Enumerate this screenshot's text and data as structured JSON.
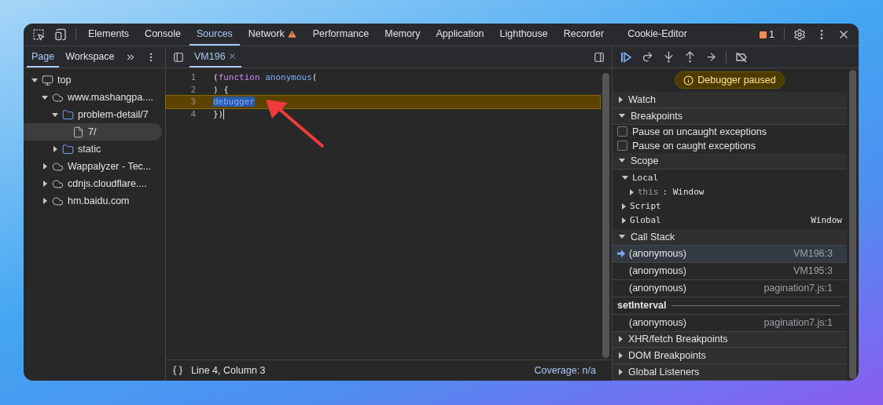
{
  "main_tabs": [
    {
      "label": "Elements",
      "selected": false,
      "warning": false
    },
    {
      "label": "Console",
      "selected": false,
      "warning": false
    },
    {
      "label": "Sources",
      "selected": true,
      "warning": false
    },
    {
      "label": "Network",
      "selected": false,
      "warning": true
    },
    {
      "label": "Performance",
      "selected": false,
      "warning": false
    },
    {
      "label": "Memory",
      "selected": false,
      "warning": false
    },
    {
      "label": "Application",
      "selected": false,
      "warning": false
    },
    {
      "label": "Lighthouse",
      "selected": false,
      "warning": false
    },
    {
      "label": "Recorder",
      "selected": false,
      "warning": false
    },
    {
      "label": "Cookie-Editor",
      "selected": false,
      "warning": false
    }
  ],
  "issues_count": "1",
  "navigator": {
    "tabs": [
      {
        "label": "Page",
        "selected": true
      },
      {
        "label": "Workspace",
        "selected": false
      }
    ],
    "tree": [
      {
        "label": "top",
        "kind": "frame",
        "expanded": true,
        "selected": false,
        "children": [
          {
            "label": "www.mashangpa....",
            "kind": "domain",
            "expanded": true,
            "selected": false,
            "children": [
              {
                "label": "problem-detail/7",
                "kind": "folder",
                "expanded": true,
                "selected": false,
                "children": [
                  {
                    "label": "7/",
                    "kind": "file",
                    "expanded": false,
                    "selected": true
                  }
                ]
              },
              {
                "label": "static",
                "kind": "folder",
                "expanded": false,
                "selected": false
              }
            ]
          },
          {
            "label": "Wappalyzer - Tec...",
            "kind": "domain",
            "expanded": false,
            "selected": false
          },
          {
            "label": "cdnjs.cloudflare....",
            "kind": "domain",
            "expanded": false,
            "selected": false
          },
          {
            "label": "hm.baidu.com",
            "kind": "domain",
            "expanded": false,
            "selected": false
          }
        ]
      }
    ]
  },
  "editor": {
    "file_tab": {
      "label": "VM196",
      "selected": true
    },
    "lines": [
      {
        "number": "1",
        "paused": false,
        "cursor": false,
        "tokens": [
          {
            "kind": "punct",
            "text": "("
          },
          {
            "kind": "keyword",
            "text": "function "
          },
          {
            "kind": "name",
            "text": "anonymous"
          },
          {
            "kind": "punct",
            "text": "("
          }
        ]
      },
      {
        "number": "2",
        "paused": false,
        "cursor": false,
        "tokens": [
          {
            "kind": "punct",
            "text": ") {"
          }
        ]
      },
      {
        "number": "3",
        "paused": true,
        "cursor": false,
        "tokens": [
          {
            "kind": "selected",
            "text": "debugger"
          }
        ]
      },
      {
        "number": "4",
        "paused": false,
        "cursor": true,
        "tokens": [
          {
            "kind": "punct",
            "text": "})"
          }
        ]
      }
    ],
    "status": {
      "position": "Line 4, Column 3",
      "coverage": "Coverage: n/a"
    }
  },
  "debugger": {
    "banner": "Debugger paused",
    "sections": [
      {
        "title": "Watch",
        "expanded": false
      },
      {
        "title": "Breakpoints",
        "expanded": true,
        "kind": "checkboxes",
        "items": [
          {
            "label": "Pause on uncaught exceptions",
            "checked": false
          },
          {
            "label": "Pause on caught exceptions",
            "checked": false
          }
        ]
      },
      {
        "title": "Scope",
        "expanded": true,
        "kind": "scope",
        "items": [
          {
            "name": "Local",
            "expanded": true,
            "children": [
              {
                "name": "this",
                "separator": ":",
                "value": "Window",
                "expanded": false
              }
            ]
          },
          {
            "name": "Script",
            "expanded": false
          },
          {
            "name": "Global",
            "value": "Window",
            "expanded": false
          }
        ]
      },
      {
        "title": "Call Stack",
        "expanded": true,
        "kind": "frames",
        "items": [
          {
            "kind": "frame",
            "name": "(anonymous)",
            "location": "VM196:3",
            "selected": true
          },
          {
            "kind": "frame",
            "name": "(anonymous)",
            "location": "VM195:3",
            "selected": false
          },
          {
            "kind": "frame",
            "name": "(anonymous)",
            "location": "pagination7.js:1",
            "selected": false
          },
          {
            "kind": "async",
            "name": "setInterval"
          },
          {
            "kind": "frame",
            "name": "(anonymous)",
            "location": "pagination7.js:1",
            "selected": false
          }
        ]
      },
      {
        "title": "XHR/fetch Breakpoints",
        "expanded": false
      },
      {
        "title": "DOM Breakpoints",
        "expanded": false
      },
      {
        "title": "Global Listeners",
        "expanded": false
      }
    ]
  }
}
